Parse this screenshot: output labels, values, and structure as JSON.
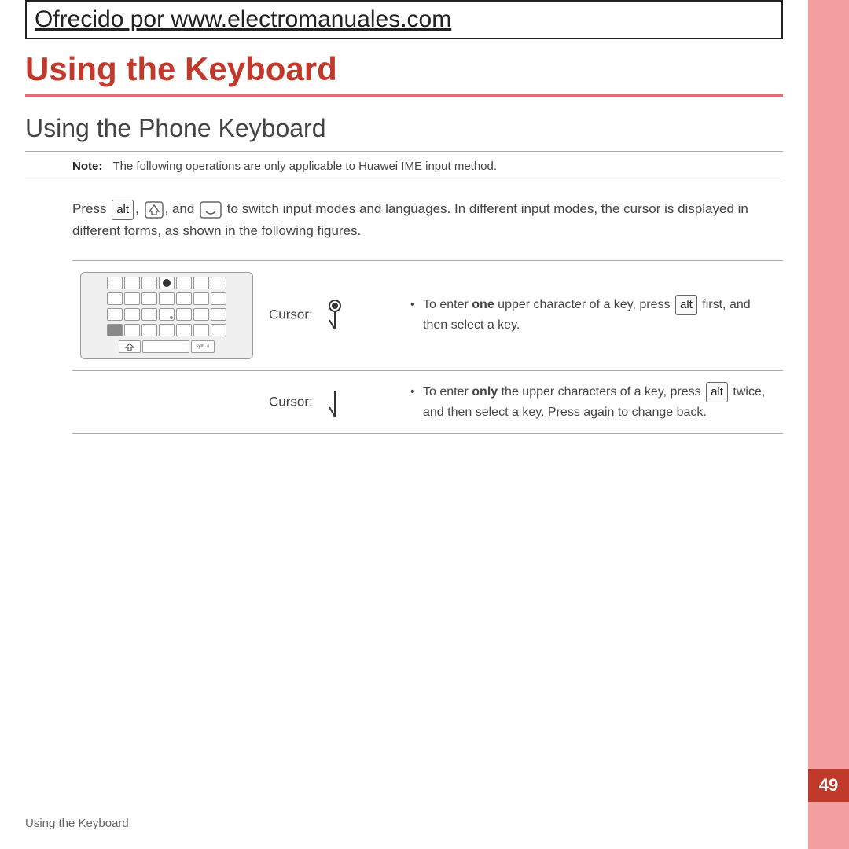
{
  "banner": {
    "text": "Ofrecido por www.electromanuales.com"
  },
  "chapter_title": "Using the Keyboard",
  "section_title": "Using the Phone Keyboard",
  "note": {
    "label": "Note:",
    "text": "The following operations are only applicable to Huawei IME input method."
  },
  "main_paragraph": {
    "prefix": "Press",
    "key1": "alt",
    "key2": "⇧",
    "key3_label": "smile",
    "suffix": "to switch input modes and languages. In different input modes, the cursor is displayed in different forms, as shown in the following figures.",
    "and": "and"
  },
  "rows": [
    {
      "cursor_label": "Cursor:",
      "cursor_icon": "fork-filled",
      "bullet": "To enter",
      "bold_word": "one",
      "desc_rest": "upper character of a key, press",
      "key": "alt",
      "desc_end": "first, and then select a key.",
      "show_keyboard": true
    },
    {
      "cursor_label": "Cursor:",
      "cursor_icon": "fork-empty",
      "bullet": "To enter",
      "bold_word": "only",
      "desc_rest": "the upper characters of a key, press",
      "key": "alt",
      "desc_end": "twice, and then select a key. Press again to change back.",
      "show_keyboard": false
    }
  ],
  "footer": {
    "text": "Using the Keyboard"
  },
  "page_number": "49",
  "colors": {
    "red": "#c0392b",
    "pink_bar": "#f4a0a0",
    "divider": "#e07070"
  }
}
